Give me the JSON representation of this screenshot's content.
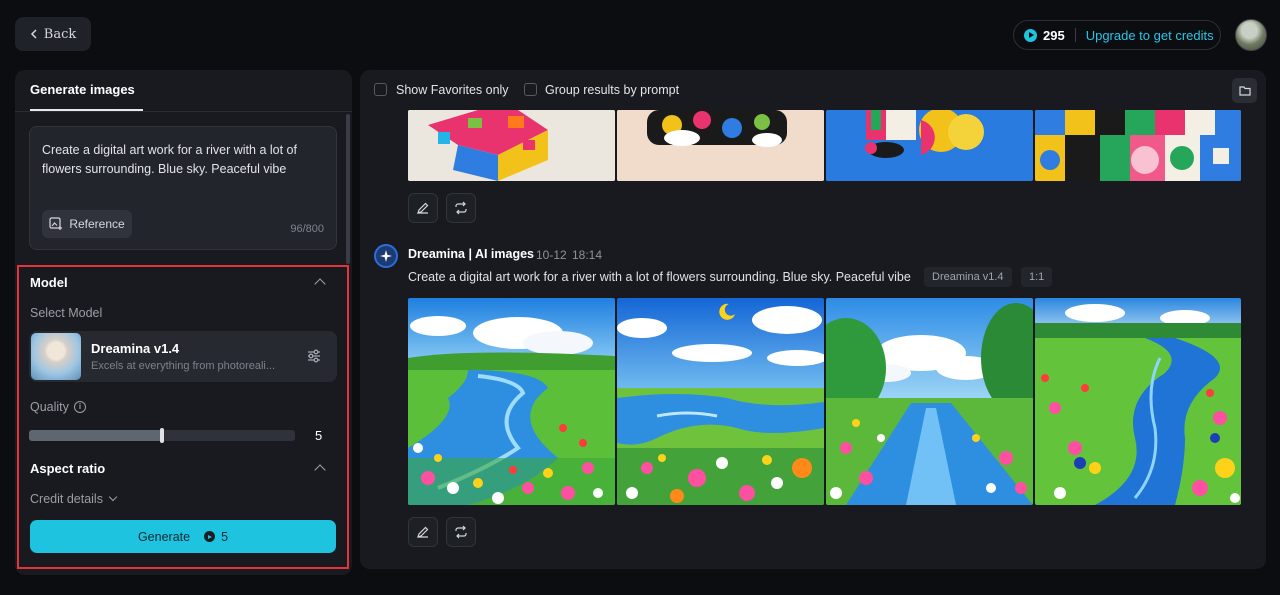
{
  "topbar": {
    "back_label": "Back",
    "credits_count": "295",
    "upgrade_label": "Upgrade to get credits"
  },
  "left": {
    "tab_label": "Generate images",
    "prompt_text": "Create a digital art work for a river with a lot of flowers surrounding. Blue sky. Peaceful vibe",
    "reference_label": "Reference",
    "char_count": "96/800",
    "model_section_title": "Model",
    "select_model_label": "Select Model",
    "model_name": "Dreamina v1.4",
    "model_desc": "Excels at everything from photoreali...",
    "quality_label": "Quality",
    "quality_value": "5",
    "quality_fraction": 0.5,
    "aspect_ratio_title": "Aspect ratio",
    "credit_details_label": "Credit details",
    "generate_label": "Generate",
    "generate_cost": "5"
  },
  "right": {
    "show_favorites_label": "Show Favorites only",
    "group_results_label": "Group results by prompt",
    "result": {
      "author": "Dreamina | AI images",
      "date": "10-12",
      "time": "18:14",
      "prompt": "Create a digital art work for a river with a lot of flowers surrounding. Blue sky. Peaceful vibe",
      "model_tag": "Dreamina v1.4",
      "ratio_tag": "1:1"
    }
  },
  "colors": {
    "accent": "#1ec3df",
    "highlight_border": "#e3343a",
    "panel_bg": "#181a1f",
    "page_bg": "#0c0d10"
  }
}
